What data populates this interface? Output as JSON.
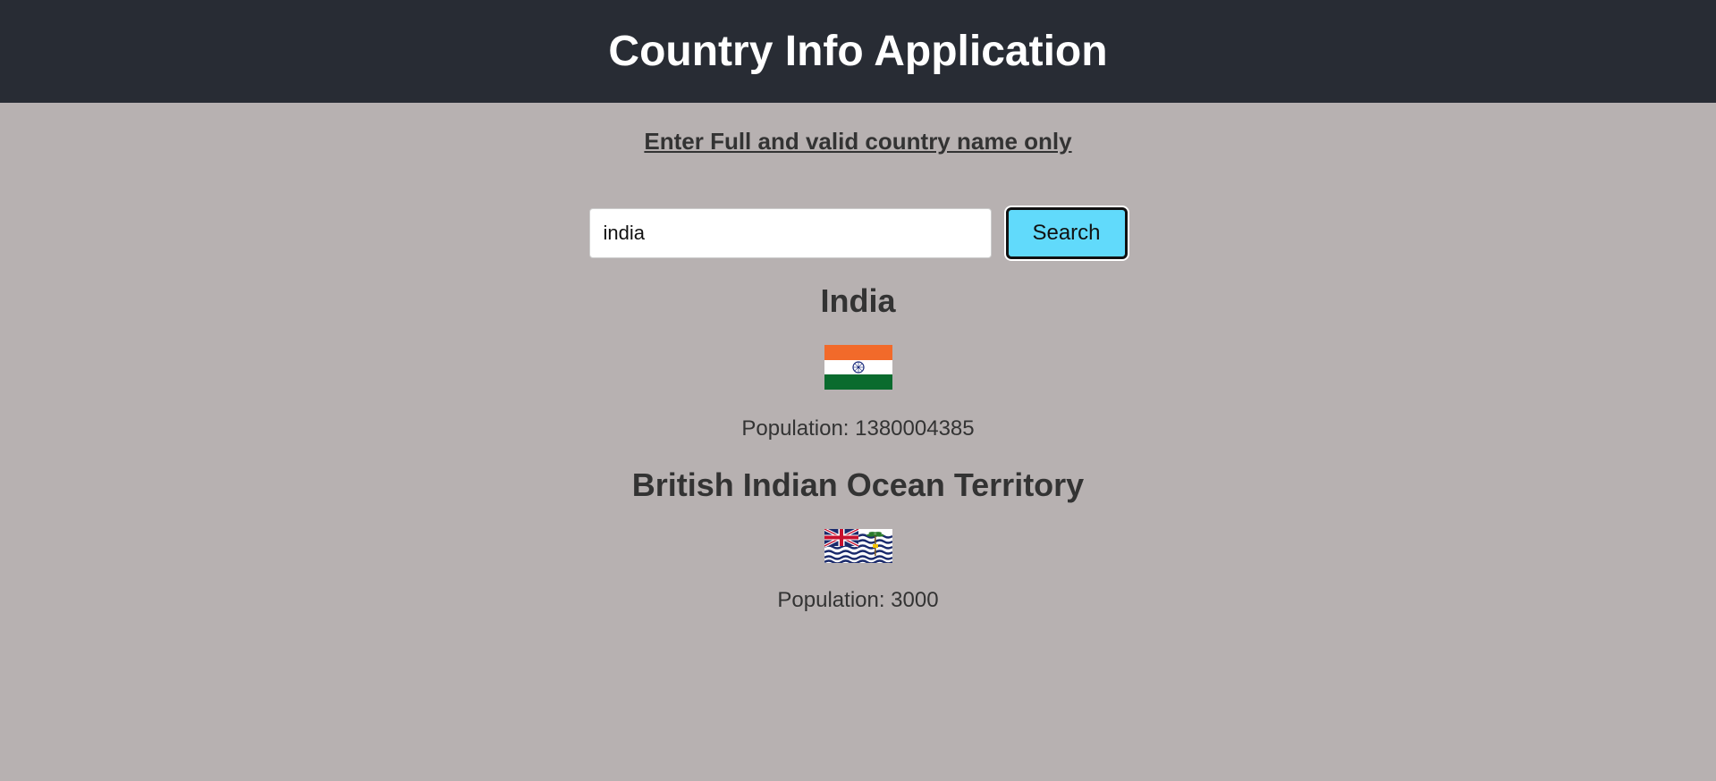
{
  "header": {
    "title": "Country Info Application"
  },
  "instruction": "Enter Full and valid country name only",
  "search": {
    "value": "india",
    "button_label": "Search"
  },
  "results": [
    {
      "name": "India",
      "flag_icon": "india-flag-icon",
      "population_label": "Population: 1380004385"
    },
    {
      "name": "British Indian Ocean Territory",
      "flag_icon": "british-indian-ocean-territory-flag-icon",
      "population_label": "Population: 3000"
    }
  ],
  "colors": {
    "header_bg": "#282c34",
    "page_bg": "#b7b1b1",
    "button_bg": "#61dafb"
  }
}
